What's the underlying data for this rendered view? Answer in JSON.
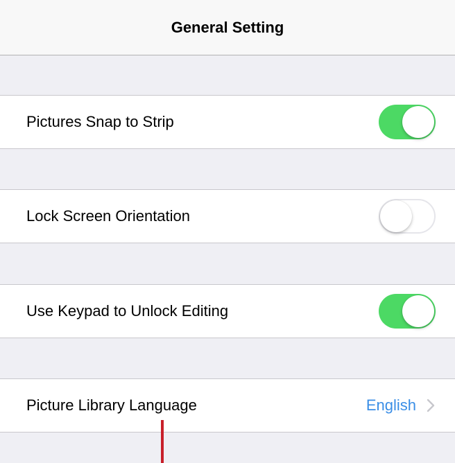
{
  "header": {
    "title": "General Setting"
  },
  "settings": [
    {
      "label": "Pictures Snap to Strip",
      "type": "toggle",
      "state": "on"
    },
    {
      "label": "Lock Screen Orientation",
      "type": "toggle",
      "state": "off"
    },
    {
      "label": "Use Keypad to Unlock Editing",
      "type": "toggle",
      "state": "on"
    },
    {
      "label": "Picture Library Language",
      "type": "disclosure",
      "value": "English",
      "icon": "chevron-right-icon"
    }
  ],
  "colors": {
    "toggle_on": "#4cd964",
    "link_value": "#3a8ee6",
    "background": "#efeff4",
    "cursor_marker": "#c8202a"
  }
}
